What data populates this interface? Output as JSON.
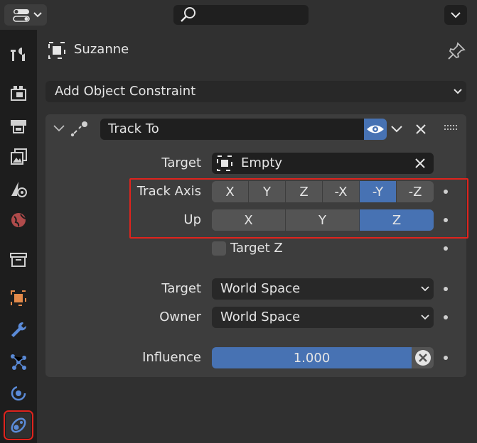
{
  "header": {
    "editor_type_icon": "properties-editor-icon",
    "search_icon": "search-icon"
  },
  "tabs": [
    {
      "name": "tool-tab",
      "icon": "tool-icon"
    },
    {
      "name": "render-tab",
      "icon": "render-icon"
    },
    {
      "name": "output-tab",
      "icon": "output-icon"
    },
    {
      "name": "view-layer-tab",
      "icon": "view-layer-icon"
    },
    {
      "name": "scene-tab",
      "icon": "scene-icon"
    },
    {
      "name": "world-tab",
      "icon": "world-icon"
    },
    {
      "name": "collection-tab",
      "icon": "collection-icon"
    },
    {
      "name": "object-tab",
      "icon": "object-icon"
    },
    {
      "name": "modifier-tab",
      "icon": "wrench-icon"
    },
    {
      "name": "particles-tab",
      "icon": "particles-icon"
    },
    {
      "name": "physics-tab",
      "icon": "physics-icon"
    },
    {
      "name": "constraints-tab",
      "icon": "object-constraint-icon",
      "active": true
    }
  ],
  "object": {
    "name": "Suzanne"
  },
  "add_constraint": {
    "label": "Add Object Constraint"
  },
  "constraint": {
    "name": "Track To",
    "target_label": "Target",
    "target_value": "Empty",
    "track_axis_label": "Track Axis",
    "track_axis_options": [
      "X",
      "Y",
      "Z",
      "-X",
      "-Y",
      "-Z"
    ],
    "track_axis_selected": "-Y",
    "up_label": "Up",
    "up_options": [
      "X",
      "Y",
      "Z"
    ],
    "up_selected": "Z",
    "target_z_label": "Target Z",
    "target_z_checked": false,
    "target_space_label": "Target",
    "target_space_value": "World Space",
    "owner_space_label": "Owner",
    "owner_space_value": "World Space",
    "influence_label": "Influence",
    "influence_value": "1.000"
  },
  "colors": {
    "accent": "#4772b3",
    "highlight": "#e0231d"
  }
}
